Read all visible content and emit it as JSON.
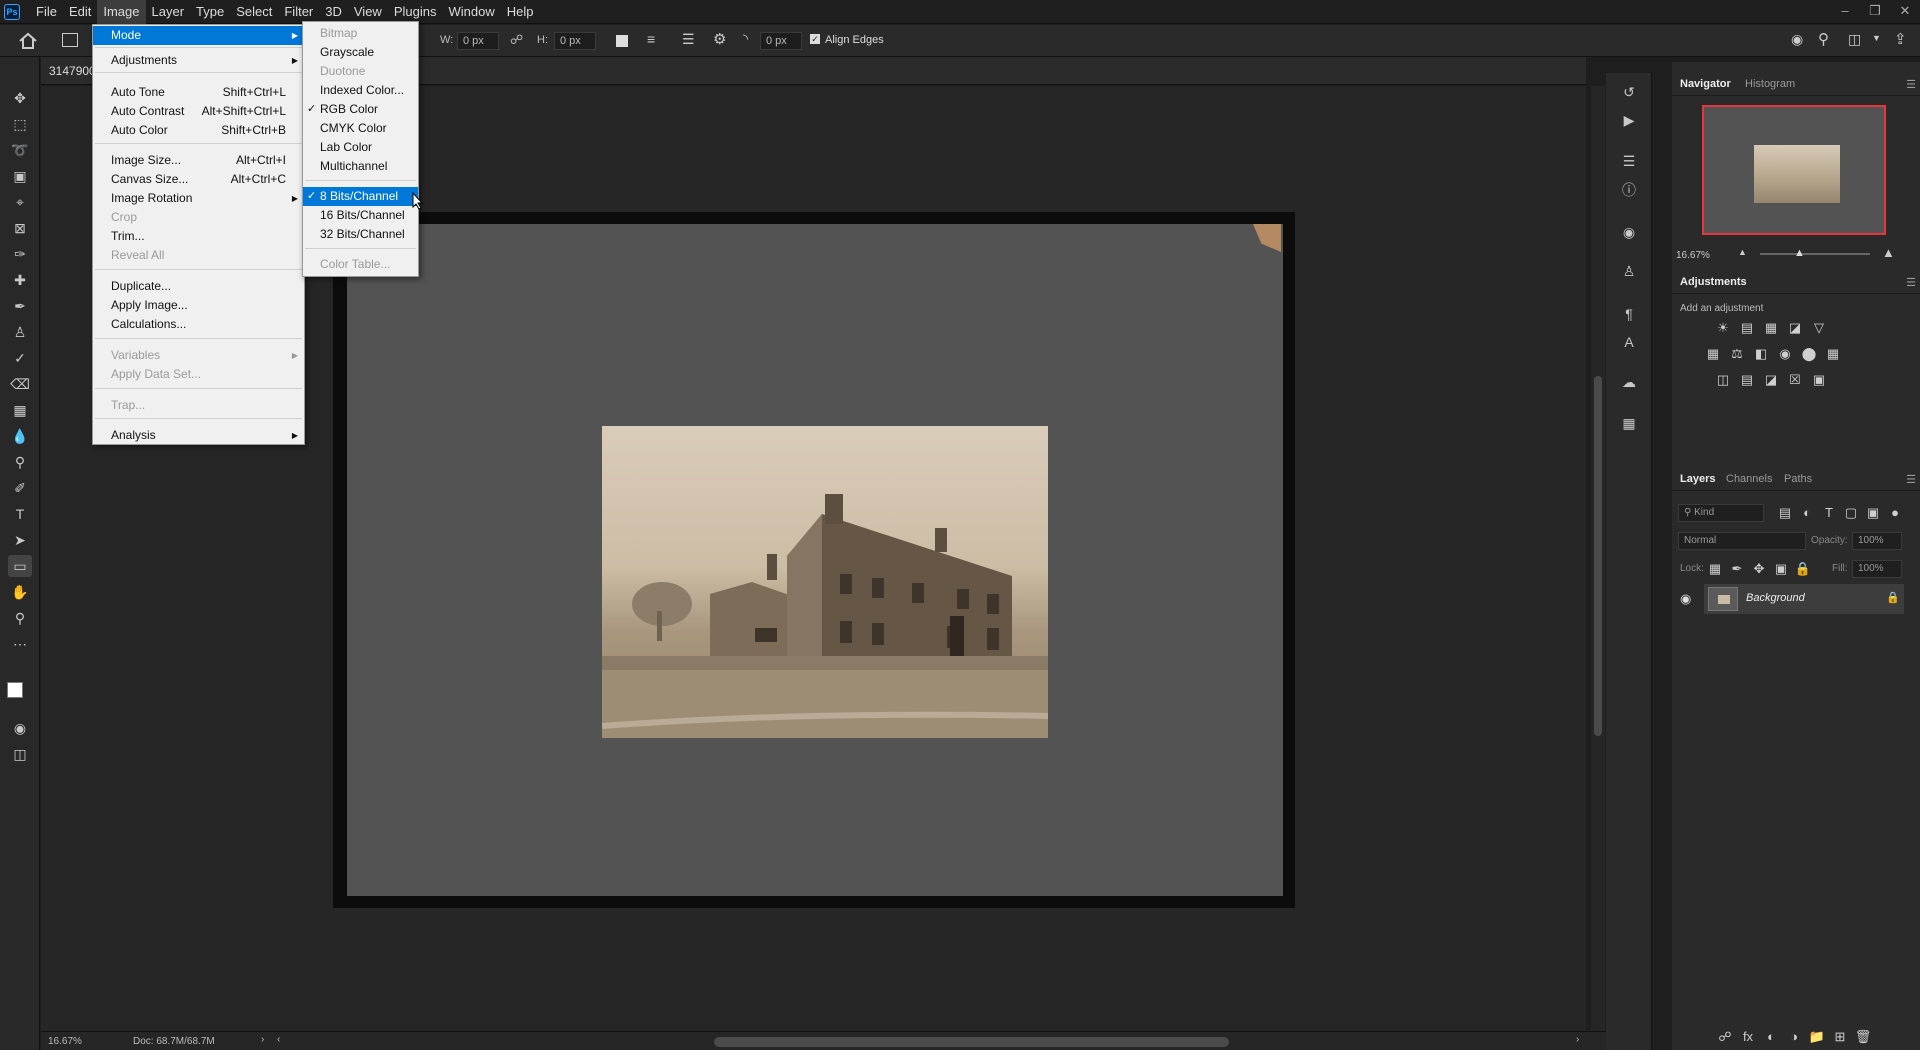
{
  "menubar": {
    "logo": "Ps",
    "items": [
      "File",
      "Edit",
      "Image",
      "Layer",
      "Type",
      "Select",
      "Filter",
      "3D",
      "View",
      "Plugins",
      "Window",
      "Help"
    ],
    "active": "Image"
  },
  "options_bar": {
    "w_label": "W:",
    "w_value": "0 px",
    "h_label": "H:",
    "h_value": "0 px",
    "radius_value": "0 px",
    "align_edges_label": "Align Edges"
  },
  "document_tab": {
    "title": "3147900"
  },
  "image_menu": {
    "items": [
      {
        "label": "Mode",
        "shortcut": "",
        "submenu": true,
        "state": "highlighted"
      },
      {
        "label": "Adjustments",
        "shortcut": "",
        "submenu": true,
        "state": "normal"
      },
      {
        "label": "Auto Tone",
        "shortcut": "Shift+Ctrl+L",
        "submenu": false,
        "state": "normal"
      },
      {
        "label": "Auto Contrast",
        "shortcut": "Alt+Shift+Ctrl+L",
        "submenu": false,
        "state": "normal"
      },
      {
        "label": "Auto Color",
        "shortcut": "Shift+Ctrl+B",
        "submenu": false,
        "state": "normal"
      },
      {
        "label": "Image Size...",
        "shortcut": "Alt+Ctrl+I",
        "submenu": false,
        "state": "normal"
      },
      {
        "label": "Canvas Size...",
        "shortcut": "Alt+Ctrl+C",
        "submenu": false,
        "state": "normal"
      },
      {
        "label": "Image Rotation",
        "shortcut": "",
        "submenu": true,
        "state": "normal"
      },
      {
        "label": "Crop",
        "shortcut": "",
        "submenu": false,
        "state": "disabled"
      },
      {
        "label": "Trim...",
        "shortcut": "",
        "submenu": false,
        "state": "normal"
      },
      {
        "label": "Reveal All",
        "shortcut": "",
        "submenu": false,
        "state": "disabled"
      },
      {
        "label": "Duplicate...",
        "shortcut": "",
        "submenu": false,
        "state": "normal"
      },
      {
        "label": "Apply Image...",
        "shortcut": "",
        "submenu": false,
        "state": "normal"
      },
      {
        "label": "Calculations...",
        "shortcut": "",
        "submenu": false,
        "state": "normal"
      },
      {
        "label": "Variables",
        "shortcut": "",
        "submenu": true,
        "state": "disabled"
      },
      {
        "label": "Apply Data Set...",
        "shortcut": "",
        "submenu": false,
        "state": "disabled"
      },
      {
        "label": "Trap...",
        "shortcut": "",
        "submenu": false,
        "state": "disabled"
      },
      {
        "label": "Analysis",
        "shortcut": "",
        "submenu": true,
        "state": "normal"
      }
    ]
  },
  "mode_menu": {
    "items": [
      {
        "label": "Bitmap",
        "checked": false,
        "state": "disabled"
      },
      {
        "label": "Grayscale",
        "checked": false,
        "state": "normal"
      },
      {
        "label": "Duotone",
        "checked": false,
        "state": "disabled"
      },
      {
        "label": "Indexed Color...",
        "checked": false,
        "state": "normal"
      },
      {
        "label": "RGB Color",
        "checked": true,
        "state": "normal"
      },
      {
        "label": "CMYK Color",
        "checked": false,
        "state": "normal"
      },
      {
        "label": "Lab Color",
        "checked": false,
        "state": "normal"
      },
      {
        "label": "Multichannel",
        "checked": false,
        "state": "normal"
      },
      {
        "label": "8 Bits/Channel",
        "checked": true,
        "state": "highlighted"
      },
      {
        "label": "16 Bits/Channel",
        "checked": false,
        "state": "normal"
      },
      {
        "label": "32 Bits/Channel",
        "checked": false,
        "state": "normal"
      },
      {
        "label": "Color Table...",
        "checked": false,
        "state": "disabled"
      }
    ]
  },
  "navigator": {
    "tabs": [
      "Navigator",
      "Histogram"
    ],
    "zoom": "16.67%"
  },
  "adjustments": {
    "title": "Adjustments",
    "subtitle": "Add an adjustment"
  },
  "layers": {
    "tabs": [
      "Layers",
      "Channels",
      "Paths"
    ],
    "kind_placeholder": "Kind",
    "blend_mode": "Normal",
    "opacity_label": "Opacity:",
    "opacity_value": "100%",
    "lock_label": "Lock:",
    "fill_label": "Fill:",
    "fill_value": "100%",
    "layer_name": "Background"
  },
  "status": {
    "zoom": "16.67%",
    "doc": "Doc: 68.7M/68.7M"
  },
  "colors": {
    "accent": "#0078d7",
    "app_bg": "#262626",
    "panel": "#2a2a2a",
    "nav_frame": "#e8363f"
  }
}
